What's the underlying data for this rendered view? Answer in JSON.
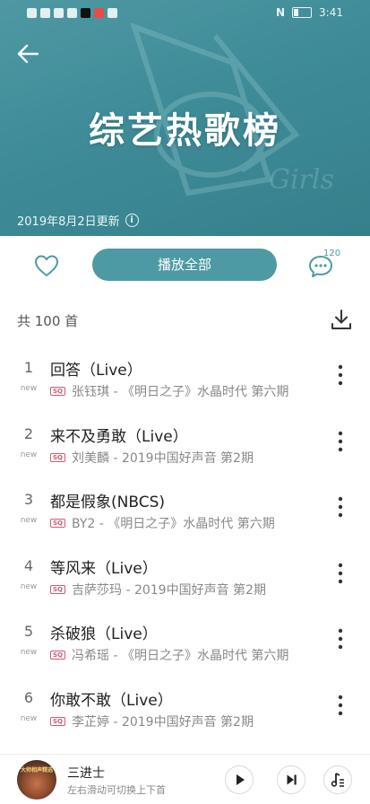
{
  "status_bar": {
    "time": "3:41"
  },
  "header": {
    "title": "综艺热歌榜",
    "updated": "2019年8月2日更新"
  },
  "actions": {
    "play_all": "播放全部",
    "comment_count": "120"
  },
  "list": {
    "total": "共 100 首"
  },
  "songs": [
    {
      "index": "1",
      "tag": "new",
      "quality": "SQ",
      "title": "回答（Live）",
      "subtitle": "张钰琪 - 《明日之子》水晶时代 第六期"
    },
    {
      "index": "2",
      "tag": "new",
      "quality": "SQ",
      "title": "来不及勇敢（Live）",
      "subtitle": "刘美麟 - 2019中国好声音 第2期"
    },
    {
      "index": "3",
      "tag": "new",
      "quality": "SQ",
      "title": "都是假象(NBCS)",
      "subtitle": "BY2 - 《明日之子》水晶时代 第六期"
    },
    {
      "index": "4",
      "tag": "new",
      "quality": "SQ",
      "title": "等风来（Live）",
      "subtitle": "吉萨莎玛 - 2019中国好声音 第2期"
    },
    {
      "index": "5",
      "tag": "new",
      "quality": "SQ",
      "title": "杀破狼（Live）",
      "subtitle": "冯希瑶 - 《明日之子》水晶时代 第六期"
    },
    {
      "index": "6",
      "tag": "new",
      "quality": "SQ",
      "title": "你敢不敢（Live）",
      "subtitle": "李芷婷 - 2019中国好声音 第2期"
    }
  ],
  "now_playing": {
    "title": "三进士",
    "hint": "左右滑动可切换上下首",
    "cover_text": "大师相声精选"
  },
  "colors": {
    "accent": "#4d9aa4",
    "header_bg": "#3e8c98",
    "sq_tag": "#d05a6f"
  },
  "icons": {
    "back": "arrow-left-icon",
    "like": "heart-icon",
    "comment": "comment-icon",
    "download": "download-icon",
    "more": "more-vertical-icon",
    "play": "play-icon",
    "next": "next-icon",
    "playlist": "playlist-icon"
  }
}
